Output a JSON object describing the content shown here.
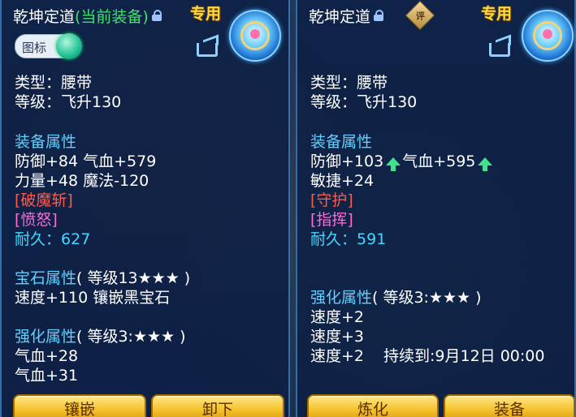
{
  "left": {
    "title": "乾坤定道",
    "title_suffix": "(当前装备)",
    "tag": "专用",
    "toggle_label": "图标",
    "type": "类型：腰带",
    "level": "等级：飞升130",
    "attr_header": "装备属性",
    "attr_line1": "防御+84 气血+579",
    "attr_line2": "力量+48 魔法-120",
    "special1": "[破魔斩]",
    "special2": "[愤怒]",
    "durability_label": "耐久：",
    "durability_value": "627",
    "gem_header": "宝石属性",
    "gem_level": "( 等级13★★★ )",
    "gem_line": "速度+110 镶嵌黑宝石",
    "enh_header": "强化属性",
    "enh_level": "( 等级3:★★★ )",
    "enh_line1": "气血+28",
    "enh_line2": "气血+31",
    "btn1": "镶嵌",
    "btn2": "卸下"
  },
  "right": {
    "title": "乾坤定道",
    "rate_badge": "评",
    "tag": "专用",
    "type": "类型：腰带",
    "level": "等级：飞升130",
    "attr_header": "装备属性",
    "attr_line1a": "防御+103",
    "attr_line1b": "气血+595",
    "attr_line2": "敏捷+24",
    "special1": "[守护]",
    "special2": "[指挥]",
    "durability_label": "耐久：",
    "durability_value": "591",
    "enh_header": "强化属性",
    "enh_level": "( 等级3:★★★ )",
    "enh_line1": "速度+2",
    "enh_line2": "速度+3",
    "enh_line3": "速度+2",
    "enh_duration": "持续到:9月12日 00:00",
    "btn1": "炼化",
    "btn2": "装备"
  },
  "colors": {
    "panel_bg": "#0c2046",
    "section_header": "#5fd0ff",
    "special_red": "#ff5a4a",
    "special_pink": "#ff6ad5",
    "durability": "#47d6ff",
    "equipped_tag": "#3fe36b",
    "exclusive_tag": "#ffd93a",
    "button": "#f3c12a"
  }
}
